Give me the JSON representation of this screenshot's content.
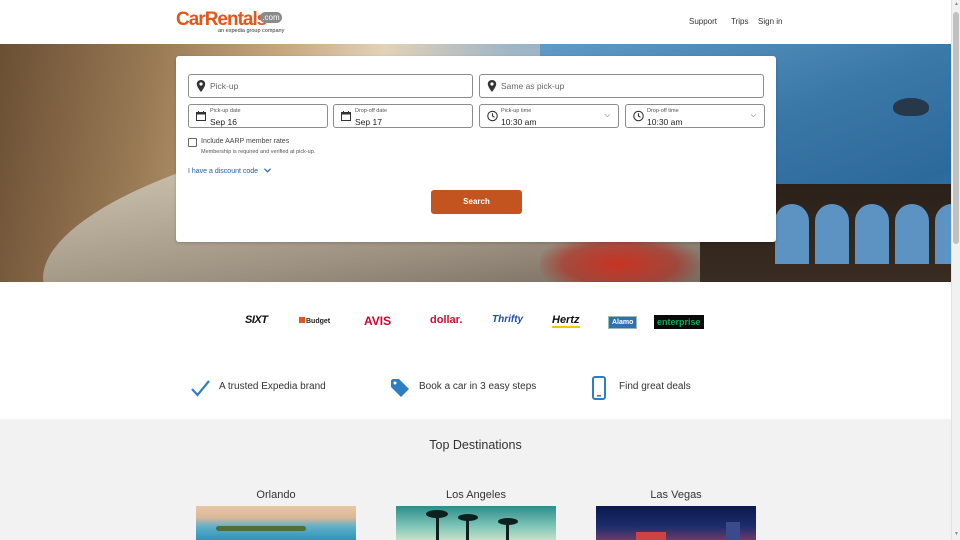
{
  "header": {
    "logo": {
      "car": "Car",
      "rentals": "Rentals",
      "com": ".com",
      "tagline": "an expedia group company"
    },
    "nav": [
      "Support",
      "Trips",
      "Sign in"
    ]
  },
  "search": {
    "pickup_placeholder": "Pick-up",
    "dropoff_placeholder": "Same as pick-up",
    "pickup_date": {
      "label": "Pick-up date",
      "value": "Sep 16"
    },
    "dropoff_date": {
      "label": "Drop-off date",
      "value": "Sep 17"
    },
    "pickup_time": {
      "label": "Pick-up time",
      "value": "10:30 am"
    },
    "dropoff_time": {
      "label": "Drop-off time",
      "value": "10:30 am"
    },
    "aarp_label": "Include AARP member rates",
    "aarp_note": "Membership is required and verified at pick-up.",
    "discount_link": "I have a discount code",
    "button": "Search"
  },
  "brands": [
    "SIXT",
    "Budget",
    "AVIS",
    "dollar.",
    "Thrifty",
    "Hertz",
    "Alamo",
    "enterprise"
  ],
  "features": [
    "A trusted Expedia brand",
    "Book a car in 3 easy steps",
    "Find great deals"
  ],
  "destinations": {
    "title": "Top Destinations",
    "cities": [
      "Orlando",
      "Los Angeles",
      "Las Vegas"
    ]
  },
  "colors": {
    "accent": "#c3531f",
    "link": "#1a5fa8",
    "logo": "#e2571b",
    "icon_blue": "#2f7ec4"
  }
}
